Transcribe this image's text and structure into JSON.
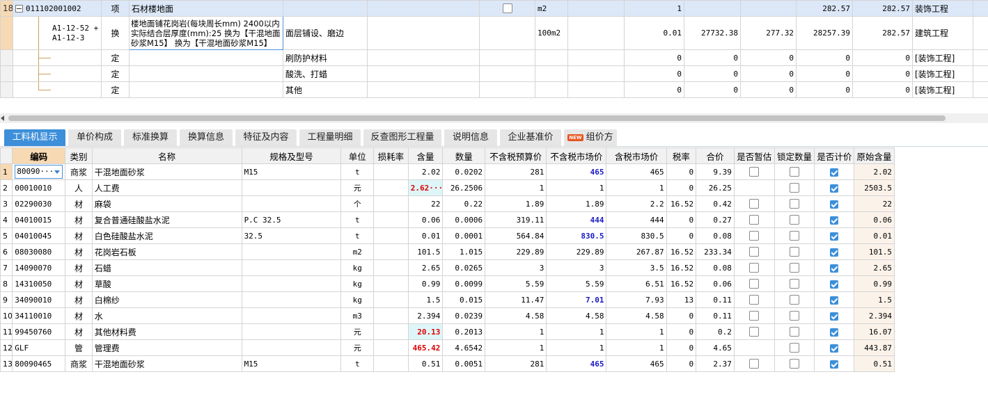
{
  "top_rows": [
    {
      "rn": "18",
      "code": "011102001002",
      "type": "项",
      "name": "石材楼地面",
      "feature": "",
      "unit": "m2",
      "qty": "1",
      "p1": "",
      "p2": "",
      "total": "282.57",
      "unit_price": "282.57",
      "category": "装饰工程"
    },
    {
      "rn": "",
      "code1": "A1-12-52 +",
      "code2": "A1-12-3",
      "type": "换",
      "name": "楼地面铺花岗岩(每块周长mm) 2400以内 实际结合层厚度(mm):25  换为【干混地面砂浆M15】  换为【干混地面砂浆M15】",
      "feature": "面层铺设、磨边",
      "unit": "100m2",
      "qty": "0.01",
      "p1": "27732.38",
      "p2": "277.32",
      "total": "28257.39",
      "unit_price": "282.57",
      "category": "建筑工程"
    },
    {
      "rn": "",
      "code": "",
      "type": "定",
      "name": "",
      "feature": "刷防护材料",
      "unit": "",
      "qty": "0",
      "p1": "0",
      "p2": "0",
      "total": "0",
      "unit_price": "0",
      "category": "[装饰工程]"
    },
    {
      "rn": "",
      "code": "",
      "type": "定",
      "name": "",
      "feature": "酸洗、打蜡",
      "unit": "",
      "qty": "0",
      "p1": "0",
      "p2": "0",
      "total": "0",
      "unit_price": "0",
      "category": "[装饰工程]"
    },
    {
      "rn": "",
      "code": "",
      "type": "定",
      "name": "",
      "feature": "其他",
      "unit": "",
      "qty": "0",
      "p1": "0",
      "p2": "0",
      "total": "0",
      "unit_price": "0",
      "category": "[装饰工程]"
    }
  ],
  "tabs": [
    "工料机显示",
    "单价构成",
    "标准换算",
    "换算信息",
    "特征及内容",
    "工程量明细",
    "反查图形工程量",
    "说明信息",
    "企业基准价",
    "组价方案"
  ],
  "new_badge": "NEW",
  "columns": [
    "编码",
    "类别",
    "名称",
    "规格及型号",
    "单位",
    "损耗率",
    "含量",
    "数量",
    "不含税预算价",
    "不含税市场价",
    "含税市场价",
    "税率",
    "合价",
    "是否暂估",
    "锁定数量",
    "是否计价",
    "原始含量"
  ],
  "rows": [
    {
      "rn": "1",
      "code": "80090···",
      "cat": "商浆",
      "name": "干混地面砂浆",
      "spec": "M15",
      "unit": "t",
      "loss": "",
      "content": "2.02",
      "qty": "0.0202",
      "budget": "281",
      "market": "465",
      "market_tax": "465",
      "tax": "0",
      "total": "9.39",
      "est": true,
      "lock": true,
      "price": true,
      "orig": "2.02"
    },
    {
      "rn": "2",
      "code": "00010010",
      "cat": "人",
      "name": "人工费",
      "spec": "",
      "unit": "元",
      "loss": "",
      "content": "2.62···",
      "qty": "26.2506",
      "budget": "1",
      "market": "1",
      "market_tax": "1",
      "tax": "0",
      "total": "26.25",
      "est": false,
      "lock": true,
      "price": true,
      "orig": "2503.5"
    },
    {
      "rn": "3",
      "code": "02290030",
      "cat": "材",
      "name": "麻袋",
      "spec": "",
      "unit": "个",
      "loss": "",
      "content": "22",
      "qty": "0.22",
      "budget": "1.89",
      "market": "1.89",
      "market_tax": "2.2",
      "tax": "16.52",
      "total": "0.42",
      "est": true,
      "lock": true,
      "price": true,
      "orig": "22"
    },
    {
      "rn": "4",
      "code": "04010015",
      "cat": "材",
      "name": "复合普通硅酸盐水泥",
      "spec": "P.C 32.5",
      "unit": "t",
      "loss": "",
      "content": "0.06",
      "qty": "0.0006",
      "budget": "319.11",
      "market": "444",
      "market_tax": "444",
      "tax": "0",
      "total": "0.27",
      "est": true,
      "lock": true,
      "price": true,
      "orig": "0.06"
    },
    {
      "rn": "5",
      "code": "04010045",
      "cat": "材",
      "name": "白色硅酸盐水泥",
      "spec": "32.5",
      "unit": "t",
      "loss": "",
      "content": "0.01",
      "qty": "0.0001",
      "budget": "564.84",
      "market": "830.5",
      "market_tax": "830.5",
      "tax": "0",
      "total": "0.08",
      "est": true,
      "lock": true,
      "price": true,
      "orig": "0.01"
    },
    {
      "rn": "6",
      "code": "08030080",
      "cat": "材",
      "name": "花岗岩石板",
      "spec": "",
      "unit": "m2",
      "loss": "",
      "content": "101.5",
      "qty": "1.015",
      "budget": "229.89",
      "market": "229.89",
      "market_tax": "267.87",
      "tax": "16.52",
      "total": "233.34",
      "est": true,
      "lock": true,
      "price": true,
      "orig": "101.5"
    },
    {
      "rn": "7",
      "code": "14090070",
      "cat": "材",
      "name": "石蜡",
      "spec": "",
      "unit": "kg",
      "loss": "",
      "content": "2.65",
      "qty": "0.0265",
      "budget": "3",
      "market": "3",
      "market_tax": "3.5",
      "tax": "16.52",
      "total": "0.08",
      "est": true,
      "lock": true,
      "price": true,
      "orig": "2.65"
    },
    {
      "rn": "8",
      "code": "14310050",
      "cat": "材",
      "name": "草酸",
      "spec": "",
      "unit": "kg",
      "loss": "",
      "content": "0.99",
      "qty": "0.0099",
      "budget": "5.59",
      "market": "5.59",
      "market_tax": "6.51",
      "tax": "16.52",
      "total": "0.06",
      "est": true,
      "lock": true,
      "price": true,
      "orig": "0.99"
    },
    {
      "rn": "9",
      "code": "34090010",
      "cat": "材",
      "name": "白棉纱",
      "spec": "",
      "unit": "kg",
      "loss": "",
      "content": "1.5",
      "qty": "0.015",
      "budget": "11.47",
      "market": "7.01",
      "market_tax": "7.93",
      "tax": "13",
      "total": "0.11",
      "est": true,
      "lock": true,
      "price": true,
      "orig": "1.5"
    },
    {
      "rn": "10",
      "code": "34110010",
      "cat": "材",
      "name": "水",
      "spec": "",
      "unit": "m3",
      "loss": "",
      "content": "2.394",
      "qty": "0.0239",
      "budget": "4.58",
      "market": "4.58",
      "market_tax": "4.58",
      "tax": "0",
      "total": "0.11",
      "est": true,
      "lock": true,
      "price": true,
      "orig": "2.394"
    },
    {
      "rn": "11",
      "code": "99450760",
      "cat": "材",
      "name": "其他材料费",
      "spec": "",
      "unit": "元",
      "loss": "",
      "content": "20.13",
      "qty": "0.2013",
      "budget": "1",
      "market": "1",
      "market_tax": "1",
      "tax": "0",
      "total": "0.2",
      "est": true,
      "lock": true,
      "price": true,
      "orig": "16.07"
    },
    {
      "rn": "12",
      "code": "GLF",
      "cat": "管",
      "name": "管理费",
      "spec": "",
      "unit": "元",
      "loss": "",
      "content": "465.42",
      "qty": "4.6542",
      "budget": "1",
      "market": "1",
      "market_tax": "1",
      "tax": "0",
      "total": "4.65",
      "est": false,
      "lock": true,
      "price": true,
      "orig": "443.87"
    },
    {
      "rn": "13",
      "code": "80090465",
      "cat": "商浆",
      "name": "干混地面砂浆",
      "spec": "M15",
      "unit": "t",
      "loss": "",
      "content": "0.51",
      "qty": "0.0051",
      "budget": "281",
      "market": "465",
      "market_tax": "465",
      "tax": "0",
      "total": "2.37",
      "est": true,
      "lock": true,
      "price": true,
      "orig": "0.51"
    }
  ],
  "colors": {
    "accent": "#3d8fd9",
    "selected_row": "#dce8f8",
    "row_header": "#f7d9b3",
    "blue_text": "#1a1ac8",
    "red_text": "#e00000"
  }
}
